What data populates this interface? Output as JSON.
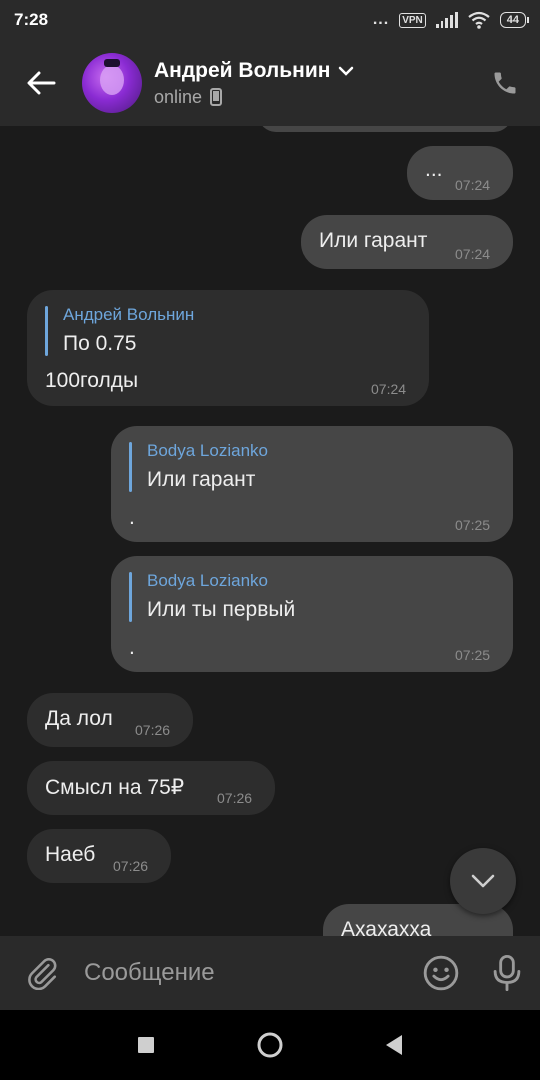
{
  "status_bar": {
    "time": "7:28",
    "dots": "...",
    "vpn": "VPN",
    "battery": "44"
  },
  "header": {
    "name": "Андрей Вольнин",
    "status": "online"
  },
  "messages": [
    {
      "dir": "out",
      "text": "...",
      "time": "07:24"
    },
    {
      "dir": "out",
      "text": "Или гарант",
      "time": "07:24"
    },
    {
      "dir": "in",
      "reply_name": "Андрей Вольнин",
      "reply_text": "По 0.75",
      "text": "100голды",
      "time": "07:24"
    },
    {
      "dir": "out",
      "reply_name": "Bodya Lozianko",
      "reply_text": "Или гарант",
      "text": ".",
      "time": "07:25"
    },
    {
      "dir": "out",
      "reply_name": "Bodya Lozianko",
      "reply_text": "Или ты первый",
      "text": ".",
      "time": "07:25"
    },
    {
      "dir": "in",
      "text": "Да лол",
      "time": "07:26"
    },
    {
      "dir": "in",
      "text": "Смысл на 75₽",
      "time": "07:26"
    },
    {
      "dir": "in",
      "text": "Наеб",
      "time": "07:26"
    },
    {
      "dir": "out",
      "text": "Ахахахха",
      "time": ""
    }
  ],
  "composer": {
    "placeholder": "Сообщение"
  },
  "colors": {
    "accent": "#6ea6dc",
    "bubble_in": "#2d2d2d",
    "bubble_out": "#464646",
    "background": "#1b1b1b",
    "bar": "#2a2a2a"
  }
}
